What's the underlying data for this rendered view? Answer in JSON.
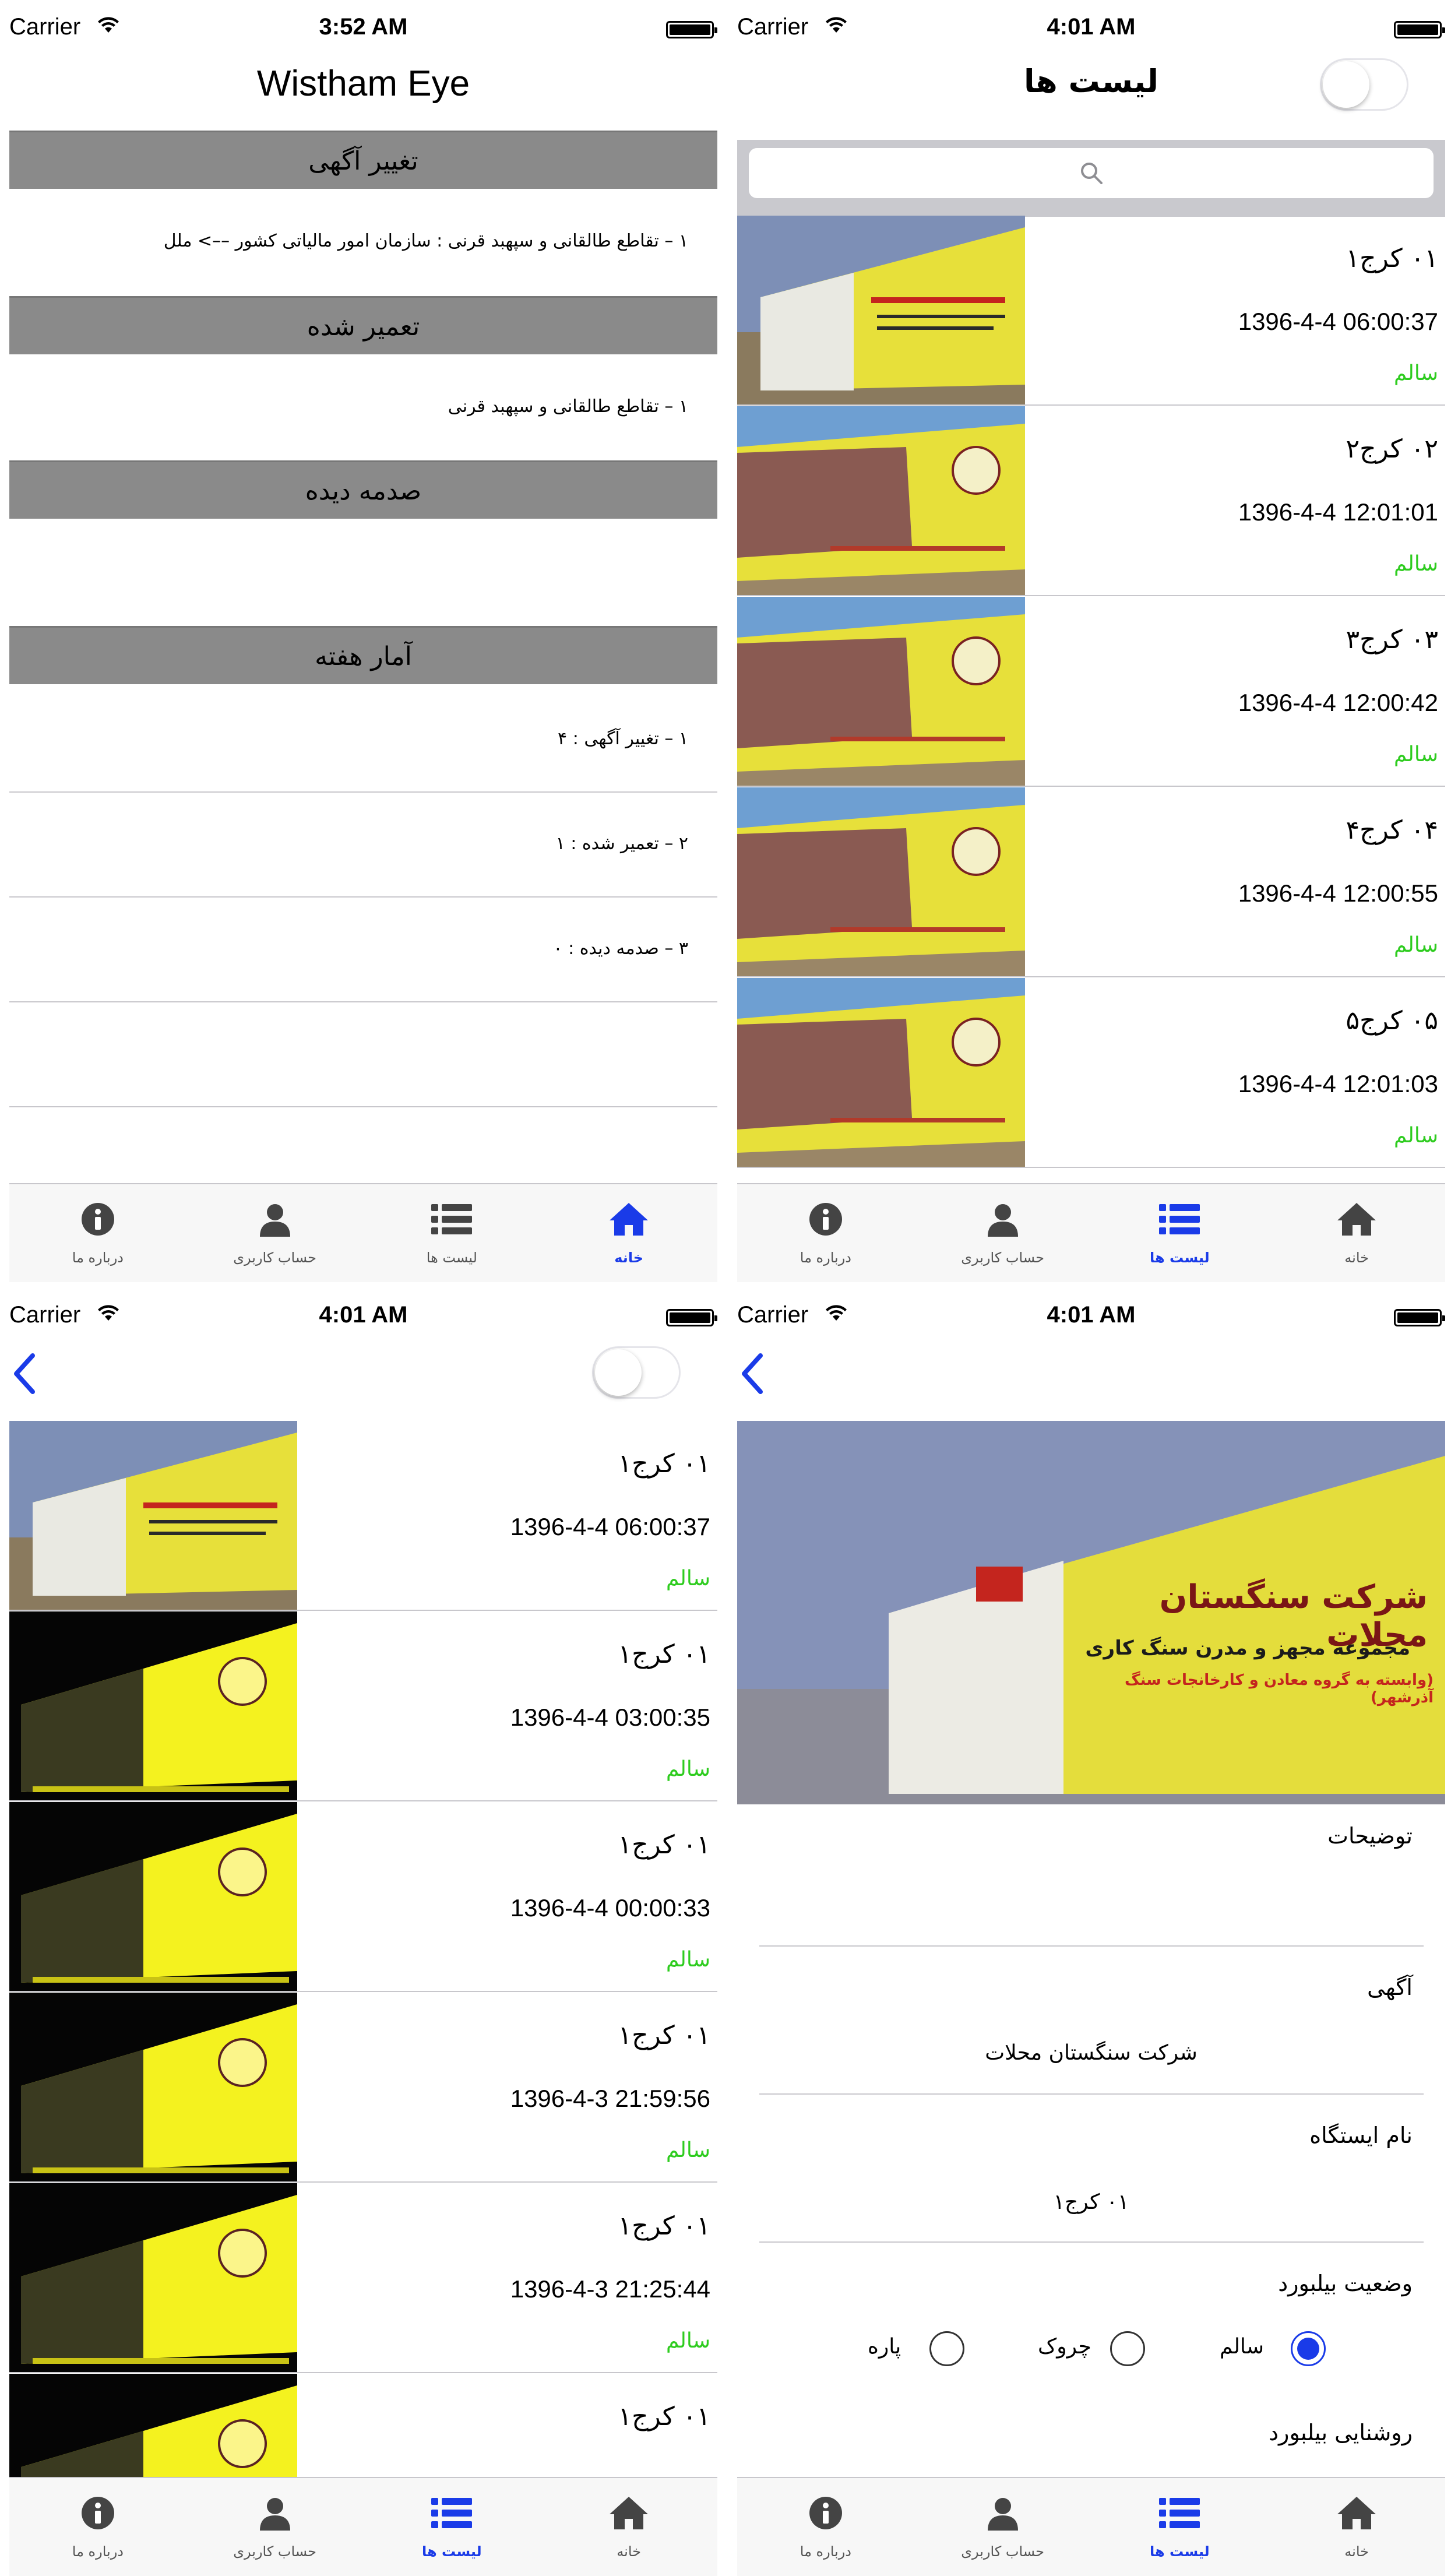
{
  "screens": {
    "home": {
      "carrier": "Carrier",
      "time": "3:52 AM",
      "title": "Wistham Eye",
      "sections": {
        "ad_change": {
          "header": "تغییر آگهی",
          "line": "۱ – تقاطع طالقانی و سپهبد قرنی  :  سازمان امور مالیاتی کشور ––> ملل"
        },
        "repaired": {
          "header": "تعمیر شده",
          "line": "۱ – تقاطع طالقانی و سپهبد قرنی"
        },
        "damaged": {
          "header": "صدمه دیده"
        },
        "weekly": {
          "header": "آمار هفته"
        }
      },
      "stats": [
        "۱ – تغییر آگهی : ۴",
        "۲ – تعمیر شده : ۱",
        "۳ – صدمه دیده : ۰"
      ]
    },
    "list": {
      "carrier": "Carrier",
      "time": "4:01 AM",
      "title": "لیست ها",
      "rows": [
        {
          "title": "۰۱ کرج۱",
          "date": "1396-4-4 06:00:37",
          "status": "سالم"
        },
        {
          "title": "۰۲ کرج۲",
          "date": "1396-4-4 12:01:01",
          "status": "سالم"
        },
        {
          "title": "۰۳ کرج۳",
          "date": "1396-4-4 12:00:42",
          "status": "سالم"
        },
        {
          "title": "۰۴ کرج۴",
          "date": "1396-4-4 12:00:55",
          "status": "سالم"
        },
        {
          "title": "۰۵ کرج۵",
          "date": "1396-4-4 12:01:03",
          "status": "سالم"
        }
      ]
    },
    "history": {
      "carrier": "Carrier",
      "time": "4:01 AM",
      "rows": [
        {
          "title": "۰۱ کرج۱",
          "date": "1396-4-4 06:00:37",
          "status": "سالم"
        },
        {
          "title": "۰۱ کرج۱",
          "date": "1396-4-4 03:00:35",
          "status": "سالم"
        },
        {
          "title": "۰۱ کرج۱",
          "date": "1396-4-4 00:00:33",
          "status": "سالم"
        },
        {
          "title": "۰۱ کرج۱",
          "date": "1396-4-3 21:59:56",
          "status": "سالم"
        },
        {
          "title": "۰۱ کرج۱",
          "date": "1396-4-3 21:25:44",
          "status": "سالم"
        },
        {
          "title": "۰۱ کرج۱",
          "date": "",
          "status": ""
        }
      ]
    },
    "detail": {
      "carrier": "Carrier",
      "time": "4:01 AM",
      "billboard_text": {
        "headline": "شرکت سنگستان محلات",
        "sub": "مجموعه مجهز و مدرن سنگ کاری",
        "red_line": "(وابسته به گروه معادن و کارخانجات سنگ آذرشهر)"
      },
      "description_label": "توضیحات",
      "ad_label": "آگهی",
      "ad_value": "شرکت سنگستان محلات",
      "station_label": "نام ایستگاه",
      "station_value": "۰۱ کرج۱",
      "status_label": "وضعیت بیلبورد",
      "status_options": [
        "سالم",
        "چروک",
        "پاره"
      ],
      "selected_status": "سالم",
      "lighting_label": "روشنایی بیلبورد"
    }
  },
  "tabbar": {
    "about": "درباره ما",
    "account": "حساب کاربری",
    "lists": "لیست ها",
    "home": "خانه"
  },
  "colors": {
    "accent": "#1a3be8",
    "ok_status": "#2ecc1f",
    "section_header": "#8a8a8a",
    "billboard_yellow": "#e7e03a"
  }
}
